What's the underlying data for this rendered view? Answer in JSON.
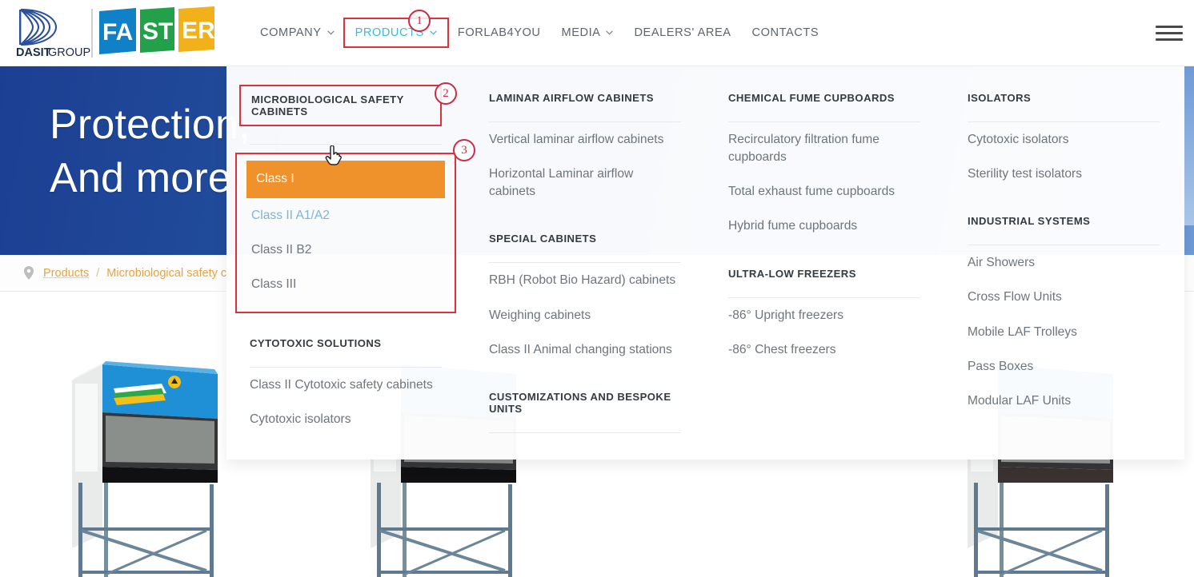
{
  "site": {
    "logo_primary": "DASIT",
    "logo_primary_suffix": "GROUP",
    "logo_brand": "FASTER"
  },
  "header": {
    "nav": [
      {
        "label": "COMPANY",
        "has_chevron": true,
        "active": false,
        "boxed": false
      },
      {
        "label": "PRODUCTS",
        "has_chevron": true,
        "active": true,
        "boxed": true,
        "badge": "1"
      },
      {
        "label": "FORLAB4YOU",
        "has_chevron": false,
        "active": false,
        "boxed": false
      },
      {
        "label": "MEDIA",
        "has_chevron": true,
        "active": false,
        "boxed": false
      },
      {
        "label": "DEALERS' AREA",
        "has_chevron": false,
        "active": false,
        "boxed": false
      },
      {
        "label": "CONTACTS",
        "has_chevron": false,
        "active": false,
        "boxed": false
      }
    ],
    "menu_toggle_icon": "hamburger-icon"
  },
  "hero": {
    "title": "Protection,\nAnd more."
  },
  "breadcrumb": {
    "pin_icon": "location-pin-icon",
    "items": [
      {
        "label": "Products",
        "is_link": true
      },
      {
        "label": "Microbiological safety ca",
        "is_link": false
      }
    ],
    "separator": "/"
  },
  "megamenu": {
    "columns": [
      {
        "groups": [
          {
            "heading": "MICROBIOLOGICAL SAFETY CABINETS",
            "heading_boxed": true,
            "badge": "2",
            "list_boxed": true,
            "list_badge": "3",
            "links": [
              {
                "label": "Class I",
                "state": "highlight"
              },
              {
                "label": "Class II A1/A2",
                "state": "accent"
              },
              {
                "label": "Class II B2",
                "state": "normal"
              },
              {
                "label": "Class III",
                "state": "normal"
              }
            ]
          },
          {
            "heading": "CYTOTOXIC SOLUTIONS",
            "heading_boxed": false,
            "list_boxed": false,
            "links": [
              {
                "label": "Class II Cytotoxic safety cabinets",
                "state": "normal"
              },
              {
                "label": "Cytotoxic isolators",
                "state": "normal"
              }
            ]
          }
        ]
      },
      {
        "groups": [
          {
            "heading": "LAMINAR AIRFLOW CABINETS",
            "heading_boxed": false,
            "list_boxed": false,
            "links": [
              {
                "label": "Vertical laminar airflow cabinets",
                "state": "normal"
              },
              {
                "label": "Horizontal Laminar airflow cabinets",
                "state": "normal"
              }
            ]
          },
          {
            "heading": "SPECIAL CABINETS",
            "heading_boxed": false,
            "list_boxed": false,
            "links": [
              {
                "label": "RBH (Robot Bio Hazard) cabinets",
                "state": "normal"
              },
              {
                "label": "Weighing cabinets",
                "state": "normal"
              },
              {
                "label": "Class II Animal changing stations",
                "state": "normal"
              }
            ]
          },
          {
            "heading": "CUSTOMIZATIONS AND BESPOKE UNITS",
            "heading_boxed": false,
            "list_boxed": false,
            "links": []
          }
        ]
      },
      {
        "groups": [
          {
            "heading": "CHEMICAL FUME CUPBOARDS",
            "heading_boxed": false,
            "list_boxed": false,
            "links": [
              {
                "label": "Recirculatory filtration fume cupboards",
                "state": "normal"
              },
              {
                "label": "Total exhaust fume cupboards",
                "state": "normal"
              },
              {
                "label": "Hybrid fume cupboards",
                "state": "normal"
              }
            ]
          },
          {
            "heading": "ULTRA-LOW FREEZERS",
            "heading_boxed": false,
            "list_boxed": false,
            "links": [
              {
                "label": "-86° Upright freezers",
                "state": "normal"
              },
              {
                "label": "-86° Chest freezers",
                "state": "normal"
              }
            ]
          }
        ]
      },
      {
        "groups": [
          {
            "heading": "ISOLATORS",
            "heading_boxed": false,
            "list_boxed": false,
            "links": [
              {
                "label": "Cytotoxic isolators",
                "state": "normal"
              },
              {
                "label": "Sterility test isolators",
                "state": "normal"
              }
            ]
          },
          {
            "heading": "INDUSTRIAL SYSTEMS",
            "heading_boxed": false,
            "list_boxed": false,
            "links": [
              {
                "label": "Air Showers",
                "state": "normal"
              },
              {
                "label": "Cross Flow Units",
                "state": "normal"
              },
              {
                "label": "Mobile LAF Trolleys",
                "state": "normal"
              },
              {
                "label": "Pass Boxes",
                "state": "normal"
              },
              {
                "label": "Modular LAF Units",
                "state": "normal"
              }
            ]
          }
        ]
      }
    ]
  },
  "annotations": {
    "badge_1": "1",
    "badge_2": "2",
    "badge_3": "3",
    "cursor_icon": "pointing-hand-cursor"
  },
  "products_strip": {
    "items": [
      {
        "alt": "microbiological-safety-cabinet-photo"
      },
      {
        "alt": "microbiological-safety-cabinet-photo"
      },
      {
        "alt": "microbiological-safety-cabinet-photo"
      },
      {
        "alt": "microbiological-safety-cabinet-photo"
      }
    ]
  },
  "colors": {
    "accent_teal": "#3fbad3",
    "highlight_orange": "#f0922b",
    "annotation_red": "#e0303c",
    "badge_red": "#cf2b45",
    "breadcrumb_orange": "#e8a33d",
    "hero_blue": "#1c3f93"
  }
}
